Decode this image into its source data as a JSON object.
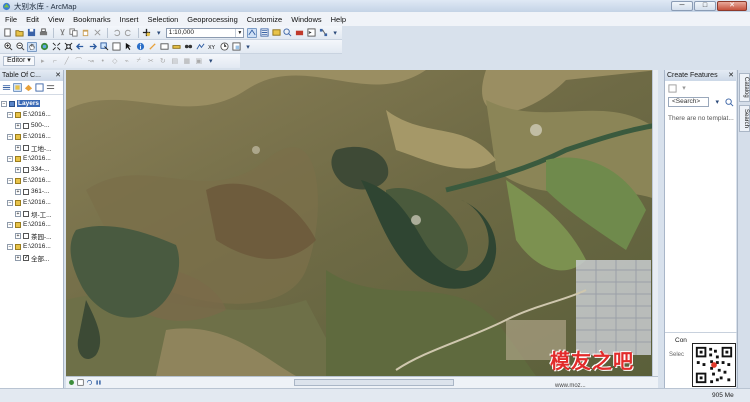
{
  "window": {
    "title": "大别水库 - ArcMap",
    "controls": [
      "─",
      "□",
      "✕"
    ]
  },
  "menu": [
    "File",
    "Edit",
    "View",
    "Bookmarks",
    "Insert",
    "Selection",
    "Geoprocessing",
    "Customize",
    "Windows",
    "Help"
  ],
  "toolbar": {
    "scale_value": "1:10,000",
    "editor_label": "Editor"
  },
  "toc": {
    "title": "Table Of C...",
    "layers_label": "Layers",
    "items": [
      {
        "type": "group",
        "label": "E:\\2016..."
      },
      {
        "type": "layer",
        "label": "500-..."
      },
      {
        "type": "group",
        "label": "E:\\2016..."
      },
      {
        "type": "layer",
        "label": "工地-..."
      },
      {
        "type": "group",
        "label": "E:\\2016..."
      },
      {
        "type": "layer",
        "label": "334-..."
      },
      {
        "type": "group",
        "label": "E:\\2016..."
      },
      {
        "type": "layer",
        "label": "361-..."
      },
      {
        "type": "group",
        "label": "E:\\2016..."
      },
      {
        "type": "layer",
        "label": "坝-工..."
      },
      {
        "type": "group",
        "label": "E:\\2016..."
      },
      {
        "type": "layer",
        "label": "茶园-..."
      },
      {
        "type": "group",
        "label": "E:\\2016..."
      },
      {
        "type": "layer",
        "label": "全部..."
      }
    ]
  },
  "create_features": {
    "title": "Create Features",
    "search_placeholder": "<Search>",
    "message": "There are no templat...",
    "bottom_label": "Con",
    "bottom_select": "Selec"
  },
  "side_tabs": [
    "Catalog",
    "Search"
  ],
  "status": {
    "coordinates": "905 Me"
  },
  "watermark": {
    "text": "模友之吧",
    "url": "www.moz..."
  }
}
